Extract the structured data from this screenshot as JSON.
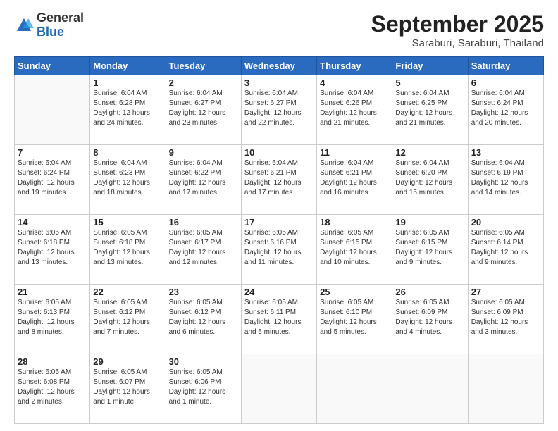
{
  "header": {
    "logo": {
      "general": "General",
      "blue": "Blue"
    },
    "title": "September 2025",
    "location": "Saraburi, Saraburi, Thailand"
  },
  "days_of_week": [
    "Sunday",
    "Monday",
    "Tuesday",
    "Wednesday",
    "Thursday",
    "Friday",
    "Saturday"
  ],
  "weeks": [
    [
      {
        "day": "",
        "info": ""
      },
      {
        "day": "1",
        "info": "Sunrise: 6:04 AM\nSunset: 6:28 PM\nDaylight: 12 hours\nand 24 minutes."
      },
      {
        "day": "2",
        "info": "Sunrise: 6:04 AM\nSunset: 6:27 PM\nDaylight: 12 hours\nand 23 minutes."
      },
      {
        "day": "3",
        "info": "Sunrise: 6:04 AM\nSunset: 6:27 PM\nDaylight: 12 hours\nand 22 minutes."
      },
      {
        "day": "4",
        "info": "Sunrise: 6:04 AM\nSunset: 6:26 PM\nDaylight: 12 hours\nand 21 minutes."
      },
      {
        "day": "5",
        "info": "Sunrise: 6:04 AM\nSunset: 6:25 PM\nDaylight: 12 hours\nand 21 minutes."
      },
      {
        "day": "6",
        "info": "Sunrise: 6:04 AM\nSunset: 6:24 PM\nDaylight: 12 hours\nand 20 minutes."
      }
    ],
    [
      {
        "day": "7",
        "info": "Sunrise: 6:04 AM\nSunset: 6:24 PM\nDaylight: 12 hours\nand 19 minutes."
      },
      {
        "day": "8",
        "info": "Sunrise: 6:04 AM\nSunset: 6:23 PM\nDaylight: 12 hours\nand 18 minutes."
      },
      {
        "day": "9",
        "info": "Sunrise: 6:04 AM\nSunset: 6:22 PM\nDaylight: 12 hours\nand 17 minutes."
      },
      {
        "day": "10",
        "info": "Sunrise: 6:04 AM\nSunset: 6:21 PM\nDaylight: 12 hours\nand 17 minutes."
      },
      {
        "day": "11",
        "info": "Sunrise: 6:04 AM\nSunset: 6:21 PM\nDaylight: 12 hours\nand 16 minutes."
      },
      {
        "day": "12",
        "info": "Sunrise: 6:04 AM\nSunset: 6:20 PM\nDaylight: 12 hours\nand 15 minutes."
      },
      {
        "day": "13",
        "info": "Sunrise: 6:04 AM\nSunset: 6:19 PM\nDaylight: 12 hours\nand 14 minutes."
      }
    ],
    [
      {
        "day": "14",
        "info": "Sunrise: 6:05 AM\nSunset: 6:18 PM\nDaylight: 12 hours\nand 13 minutes."
      },
      {
        "day": "15",
        "info": "Sunrise: 6:05 AM\nSunset: 6:18 PM\nDaylight: 12 hours\nand 13 minutes."
      },
      {
        "day": "16",
        "info": "Sunrise: 6:05 AM\nSunset: 6:17 PM\nDaylight: 12 hours\nand 12 minutes."
      },
      {
        "day": "17",
        "info": "Sunrise: 6:05 AM\nSunset: 6:16 PM\nDaylight: 12 hours\nand 11 minutes."
      },
      {
        "day": "18",
        "info": "Sunrise: 6:05 AM\nSunset: 6:15 PM\nDaylight: 12 hours\nand 10 minutes."
      },
      {
        "day": "19",
        "info": "Sunrise: 6:05 AM\nSunset: 6:15 PM\nDaylight: 12 hours\nand 9 minutes."
      },
      {
        "day": "20",
        "info": "Sunrise: 6:05 AM\nSunset: 6:14 PM\nDaylight: 12 hours\nand 9 minutes."
      }
    ],
    [
      {
        "day": "21",
        "info": "Sunrise: 6:05 AM\nSunset: 6:13 PM\nDaylight: 12 hours\nand 8 minutes."
      },
      {
        "day": "22",
        "info": "Sunrise: 6:05 AM\nSunset: 6:12 PM\nDaylight: 12 hours\nand 7 minutes."
      },
      {
        "day": "23",
        "info": "Sunrise: 6:05 AM\nSunset: 6:12 PM\nDaylight: 12 hours\nand 6 minutes."
      },
      {
        "day": "24",
        "info": "Sunrise: 6:05 AM\nSunset: 6:11 PM\nDaylight: 12 hours\nand 5 minutes."
      },
      {
        "day": "25",
        "info": "Sunrise: 6:05 AM\nSunset: 6:10 PM\nDaylight: 12 hours\nand 5 minutes."
      },
      {
        "day": "26",
        "info": "Sunrise: 6:05 AM\nSunset: 6:09 PM\nDaylight: 12 hours\nand 4 minutes."
      },
      {
        "day": "27",
        "info": "Sunrise: 6:05 AM\nSunset: 6:09 PM\nDaylight: 12 hours\nand 3 minutes."
      }
    ],
    [
      {
        "day": "28",
        "info": "Sunrise: 6:05 AM\nSunset: 6:08 PM\nDaylight: 12 hours\nand 2 minutes."
      },
      {
        "day": "29",
        "info": "Sunrise: 6:05 AM\nSunset: 6:07 PM\nDaylight: 12 hours\nand 1 minute."
      },
      {
        "day": "30",
        "info": "Sunrise: 6:05 AM\nSunset: 6:06 PM\nDaylight: 12 hours\nand 1 minute."
      },
      {
        "day": "",
        "info": ""
      },
      {
        "day": "",
        "info": ""
      },
      {
        "day": "",
        "info": ""
      },
      {
        "day": "",
        "info": ""
      }
    ]
  ]
}
